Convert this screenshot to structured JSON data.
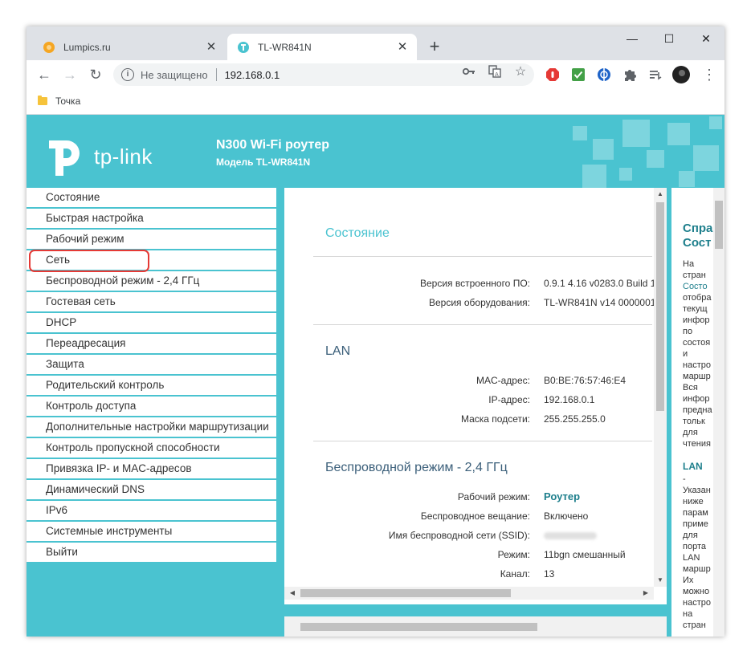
{
  "browser": {
    "tabs": [
      {
        "title": "Lumpics.ru",
        "favicon_color": "#f5a623"
      },
      {
        "title": "TL-WR841N",
        "favicon_color": "#4ac3d0"
      }
    ],
    "new_tab": "+",
    "window_controls": {
      "minimize": "—",
      "maximize": "☐",
      "close": "✕"
    },
    "address": {
      "security": "Не защищено",
      "url": "192.168.0.1"
    },
    "bookmarks": [
      {
        "label": "Точка"
      }
    ]
  },
  "router": {
    "brand": "tp-link",
    "title": "N300 Wi-Fi роутер",
    "model": "Модель TL-WR841N",
    "accent": "#4ac3d0"
  },
  "menu": {
    "items": [
      "Состояние",
      "Быстрая настройка",
      "Рабочий режим",
      "Сеть",
      "Беспроводной режим - 2,4 ГГц",
      "Гостевая сеть",
      "DHCP",
      "Переадресация",
      "Защита",
      "Родительский контроль",
      "Контроль доступа",
      "Дополнительные настройки маршрутизации",
      "Контроль пропускной способности",
      "Привязка IP- и MAC-адресов",
      "Динамический DNS",
      "IPv6",
      "Системные инструменты",
      "Выйти"
    ],
    "highlighted": "Сеть"
  },
  "status": {
    "title": "Состояние",
    "firmware_label": "Версия встроенного ПО:",
    "firmware_value": "0.9.1 4.16 v0283.0 Build 1",
    "hardware_label": "Версия оборудования:",
    "hardware_value": "TL-WR841N v14 0000001",
    "lan": {
      "title": "LAN",
      "mac_label": "MAC-адрес:",
      "mac_value": "B0:BE:76:57:46:E4",
      "ip_label": "IP-адрес:",
      "ip_value": "192.168.0.1",
      "mask_label": "Маска подсети:",
      "mask_value": "255.255.255.0"
    },
    "wireless": {
      "title": "Беспроводной режим - 2,4 ГГц",
      "mode_label": "Рабочий режим:",
      "mode_value": "Роутер",
      "broadcast_label": "Беспроводное вещание:",
      "broadcast_value": "Включено",
      "ssid_label": "Имя беспроводной сети (SSID):",
      "regime_label": "Режим:",
      "regime_value": "11bgn смешанный",
      "channel_label": "Канал:",
      "channel_value": "13"
    }
  },
  "help": {
    "title_line1": "Спра",
    "title_line2": "Сост",
    "lines1": [
      "На",
      "стран",
      "Состо",
      "отобра",
      "текущ",
      "инфор",
      "по",
      "состоя",
      "и",
      "настро",
      "маршр",
      "Вся",
      "инфор",
      "предна",
      "тольк",
      "для",
      "чтения"
    ],
    "lan_title": "LAN",
    "lines2": [
      "-",
      "Указан",
      "ниже",
      "парам",
      "приме",
      "для",
      "порта",
      "LAN",
      "маршр",
      "Их",
      "можно",
      "настро",
      "на",
      "стран"
    ]
  }
}
